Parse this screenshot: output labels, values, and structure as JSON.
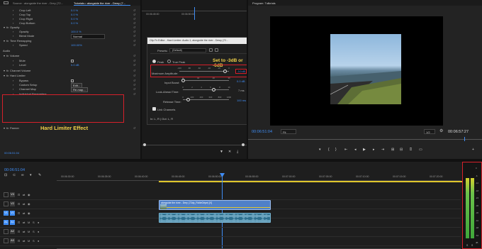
{
  "effect_controls": {
    "tab_source": "Source : alongside the river - Drey (72...",
    "tab_active": "Tutorials • alongside the river - Dewy (7...",
    "rows": [
      {
        "label": "Crop Left",
        "value": "0.0 %"
      },
      {
        "label": "Crop Top",
        "value": "0.0 %"
      },
      {
        "label": "Crop Right",
        "value": "0.0 %"
      },
      {
        "label": "Crop Bottom",
        "value": "0.0 %"
      },
      {
        "label": "Opacity",
        "value": ""
      },
      {
        "label": "Opacity",
        "value": "100.0 %"
      },
      {
        "label": "Blend Mode",
        "value": "Normal"
      },
      {
        "label": "Time Remapping",
        "value": ""
      },
      {
        "label": "Speed",
        "value": "100.00%"
      },
      {
        "label": "Audio",
        "value": ""
      },
      {
        "label": "Volume",
        "value": ""
      },
      {
        "label": "Mute",
        "value": ""
      },
      {
        "label": "Level",
        "value": "0.0 dB"
      },
      {
        "label": "Channel Volume",
        "value": ""
      },
      {
        "label": "Hard Limiter",
        "value": ""
      },
      {
        "label": "Bypass",
        "value": ""
      },
      {
        "label": "Custom Setup",
        "value": "Edit..."
      },
      {
        "label": "Channel Map",
        "value": "Re-map..."
      },
      {
        "label": "Individual Parameters",
        "value": ""
      },
      {
        "label": "Panner",
        "value": ""
      }
    ],
    "timecode": "00:06:51:04",
    "annotation": "Hard Limiter Effect"
  },
  "clip_fx_editor": {
    "title": "Clip Fx Editor - Hard Limiter: Audio 1, alongside the river - Dewy (72...",
    "presets_label": "Presets:",
    "presets_value": "(Default)",
    "peak_label": "Peak",
    "true_peak_label": "True Peak",
    "annotation": "Set to -3dB or -6dB",
    "max_amp_label": "Maximum Amplitude:",
    "max_amp_value": "-3.0 dB",
    "input_boost_label": "Input Boost:",
    "input_boost_value": "0.0 dB",
    "look_ahead_label": "Look-Ahead Time:",
    "look_ahead_value": "7 ms",
    "release_label": "Release Time:",
    "release_value": "100 ms",
    "link_label": "Link Channels",
    "footer": "In: L, R | Out: L, R",
    "scale1": [
      "-100",
      "-80",
      "-60",
      "-40",
      "-20",
      "0"
    ],
    "scale2": [
      "0",
      "10",
      "20",
      "30"
    ],
    "scale3": [
      "0",
      "2",
      "4",
      "6",
      "8",
      "10"
    ],
    "scale4": [
      "0",
      "200",
      "400",
      "600",
      "800",
      "1000"
    ]
  },
  "source_monitor": {
    "timecode": "00:06:45:00",
    "timecode2": "00:06:50:00"
  },
  "program": {
    "tab": "Program: Tutorials",
    "timecode": "00:06:51:04",
    "fit": "Fit",
    "quality": "1/2",
    "duration": "00:06:57:27"
  },
  "timeline": {
    "timecode": "00:06:51:04",
    "ruler": [
      "00:06:30:00",
      "00:06:35:00",
      "00:06:40:00",
      "00:06:45:00",
      "00:06:50:00",
      "00:06:55:00",
      "00:07:00:00",
      "00:07:05:00",
      "00:07:10:00",
      "00:07:15:00",
      "00:07:20:00"
    ],
    "tracks": [
      "V3",
      "V2",
      "V1",
      "A1",
      "A2",
      "A3"
    ],
    "video_clip": "alongside the river - Drey (72dp_Rd4eGrtpe) [V]",
    "meter_scale": [
      "0",
      "-6",
      "-12",
      "-18",
      "-24",
      "-30",
      "-36",
      "-42",
      "-48",
      "-54",
      "dB"
    ],
    "meter_channels": [
      "S",
      "S"
    ]
  },
  "colors": {
    "accent": "#3f8df5",
    "annotation": "#f2d248",
    "highlight_box": "#d6202a",
    "video_clip": "#4f80c8",
    "audio_clip": "#2d6f8e"
  }
}
